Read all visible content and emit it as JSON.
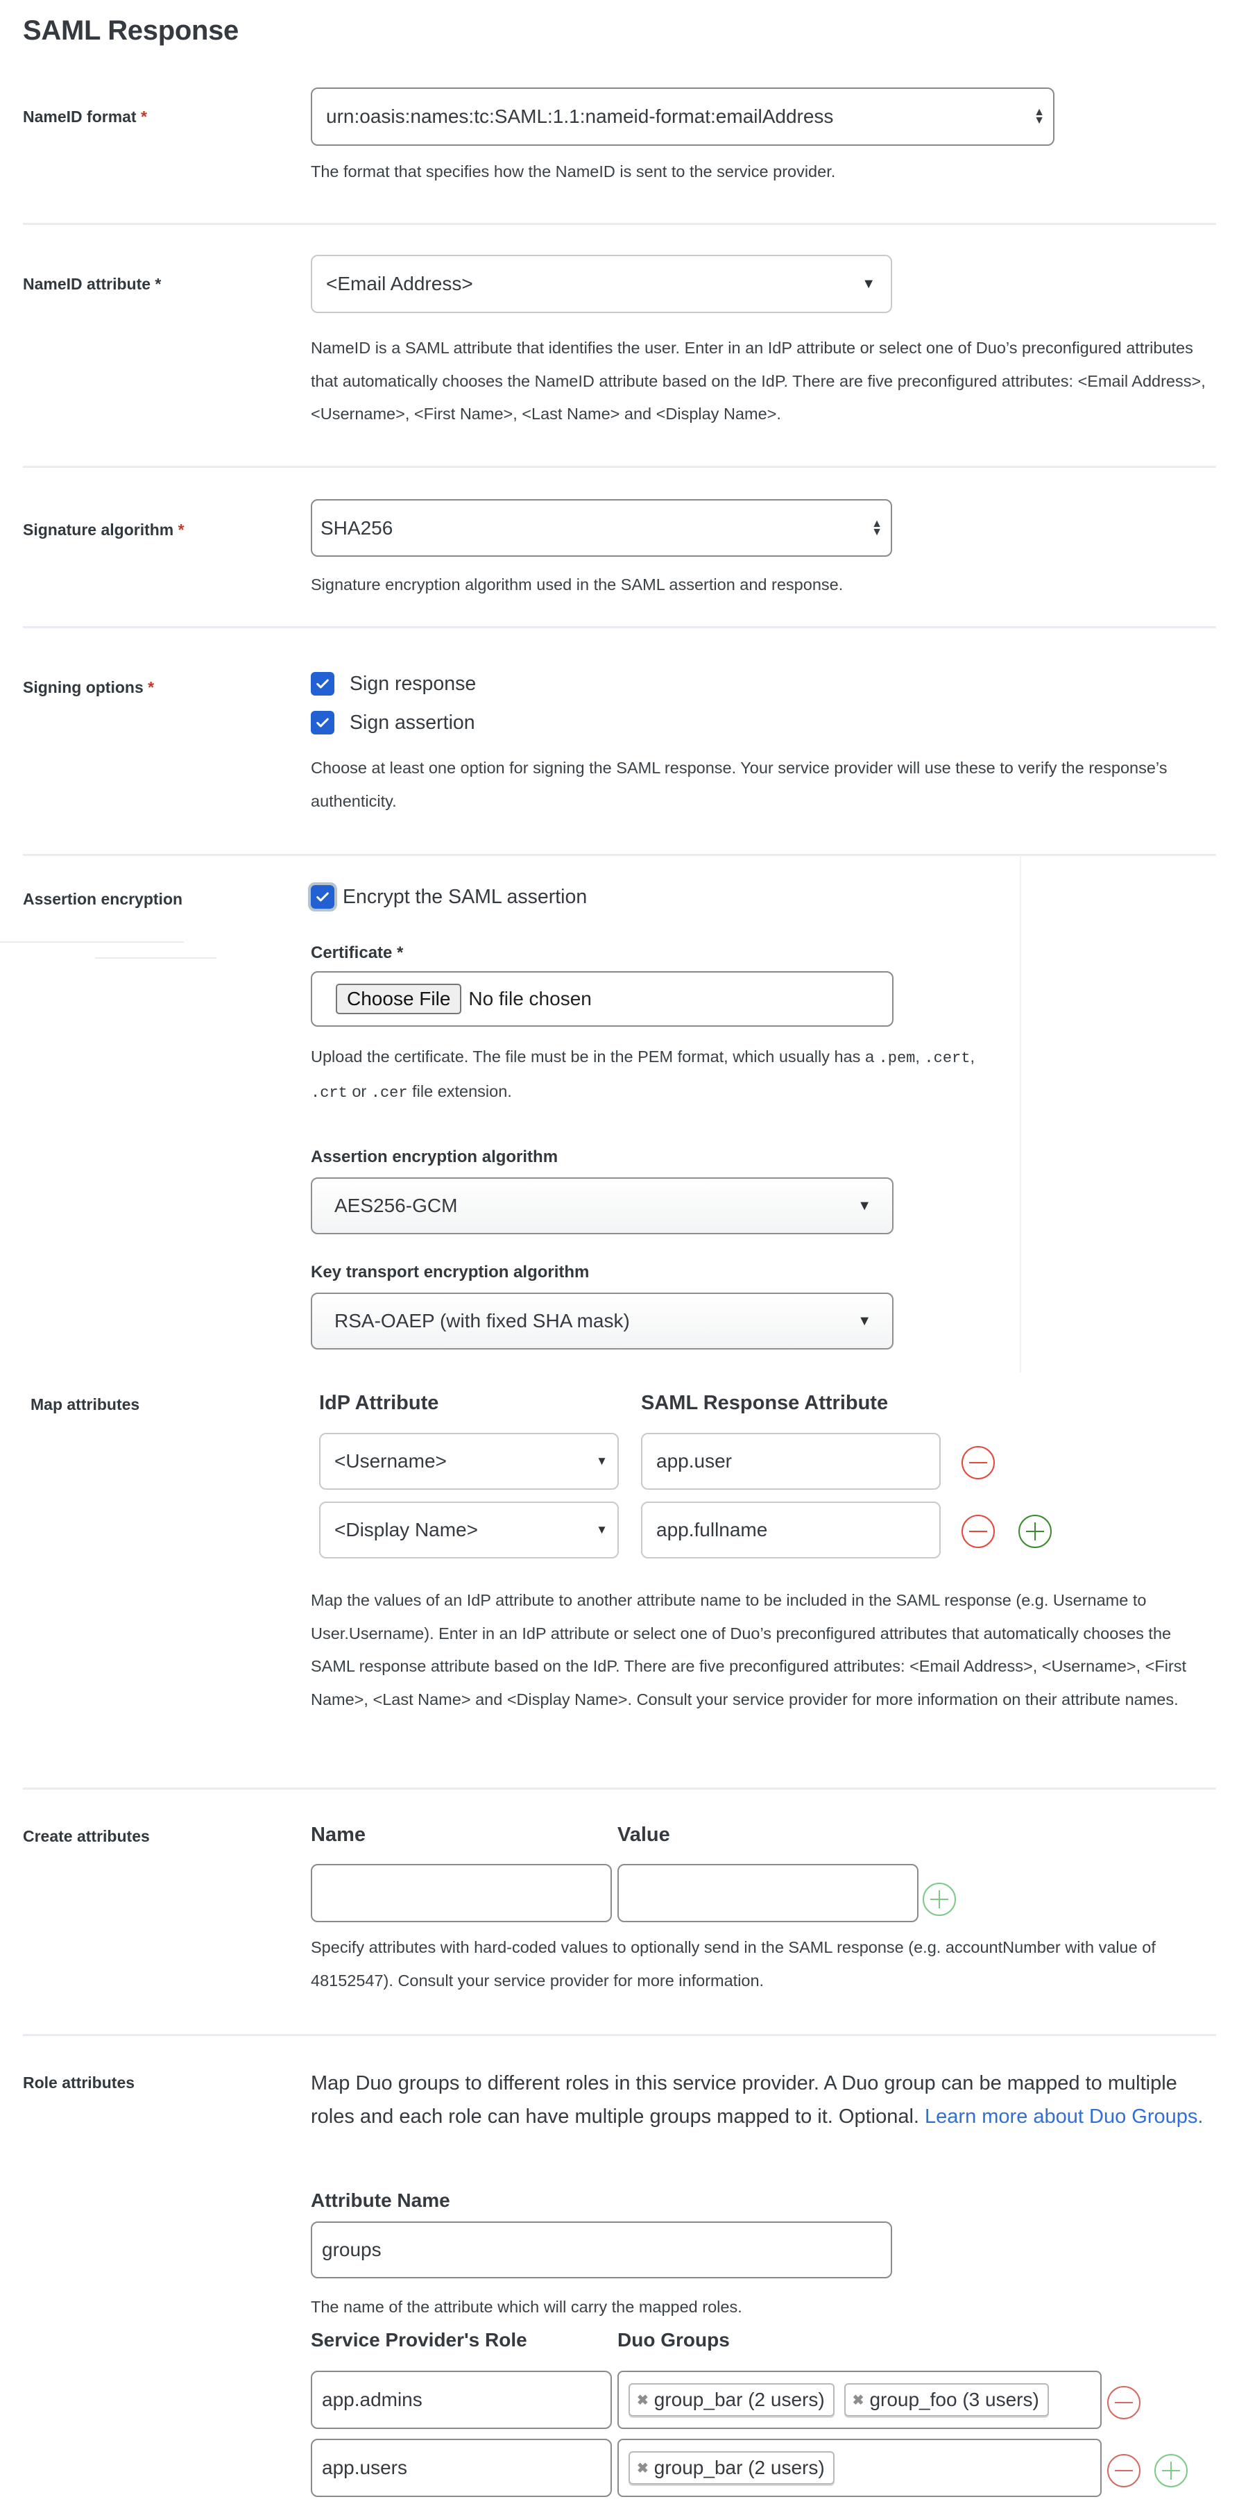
{
  "page": {
    "title": "SAML Response"
  },
  "nameid_format": {
    "label": "NameID format",
    "required_mark": "*",
    "value": "urn:oasis:names:tc:SAML:1.1:nameid-format:emailAddress",
    "help": "The format that specifies how the NameID is sent to the service provider."
  },
  "nameid_attribute": {
    "label": "NameID attribute *",
    "value": "<Email Address>",
    "help": "NameID is a SAML attribute that identifies the user. Enter in an IdP attribute or select one of Duo’s preconfigured attributes that automatically chooses the NameID attribute based on the IdP. There are five preconfigured attributes: <Email Address>, <Username>, <First Name>, <Last Name> and <Display Name>."
  },
  "signature_algorithm": {
    "label": "Signature algorithm",
    "required_mark": "*",
    "value": "SHA256",
    "help": "Signature encryption algorithm used in the SAML assertion and response."
  },
  "signing_options": {
    "label": "Signing options",
    "required_mark": "*",
    "options": [
      {
        "label": "Sign response",
        "checked": true
      },
      {
        "label": "Sign assertion",
        "checked": true
      }
    ],
    "help": "Choose at least one option for signing the SAML response. Your service provider will use these to verify the response’s authenticity."
  },
  "assertion_encryption": {
    "label": "Assertion encryption",
    "checkbox_label": "Encrypt the SAML assertion",
    "checked": true,
    "certificate": {
      "label": "Certificate *",
      "button": "Choose File",
      "status": "No file chosen",
      "help_prefix": "Upload the certificate. The file must be in the PEM format, which usually has a ",
      "ext_pem": ".pem",
      "sep1": ", ",
      "ext_cert": ".cert",
      "sep2": ",",
      "ext_crt": ".crt",
      "or": " or ",
      "ext_cer": ".cer",
      "help_suffix": " file extension."
    },
    "algorithm": {
      "label": "Assertion encryption algorithm",
      "value": "AES256-GCM"
    },
    "key_transport": {
      "label": "Key transport encryption algorithm",
      "value": "RSA-OAEP (with fixed SHA mask)"
    }
  },
  "map_attributes": {
    "label": "Map attributes",
    "col_idp": "IdP Attribute",
    "col_saml": "SAML Response Attribute",
    "rows": [
      {
        "idp": "<Username>",
        "saml": "app.user"
      },
      {
        "idp": "<Display Name>",
        "saml": "app.fullname"
      }
    ],
    "help": "Map the values of an IdP attribute to another attribute name to be included in the SAML response (e.g. Username to User.Username). Enter in an IdP attribute or select one of Duo’s preconfigured attributes that automatically chooses the SAML response attribute based on the IdP. There are five preconfigured attributes: <Email Address>, <Username>, <First Name>, <Last Name> and <Display Name>. Consult your service provider for more information on their attribute names."
  },
  "create_attributes": {
    "label": "Create attributes",
    "col_name": "Name",
    "col_value": "Value",
    "name_value": "",
    "value_value": "",
    "help": "Specify attributes with hard-coded values to optionally send in the SAML response (e.g. accountNumber with value of 48152547). Consult your service provider for more information."
  },
  "role_attributes": {
    "label": "Role attributes",
    "intro": "Map Duo groups to different roles in this service provider. A Duo group can be mapped to multiple roles and each role can have multiple groups mapped to it. Optional. ",
    "link": "Learn more about Duo Groups.",
    "attr_name_label": "Attribute Name",
    "attr_name_value": "groups",
    "attr_name_help": "The name of the attribute which will carry the mapped roles.",
    "col_role": "Service Provider's Role",
    "col_groups": "Duo Groups",
    "rows": [
      {
        "role": "app.admins",
        "groups": [
          "group_bar (2 users)",
          "group_foo (3 users)"
        ]
      },
      {
        "role": "app.users",
        "groups": [
          "group_bar (2 users)"
        ]
      }
    ]
  },
  "colors": {
    "accent": "#2261d4",
    "link": "#2f6fd6",
    "required": "#c0392b",
    "remove": "#e4473c",
    "add": "#3c8a2e",
    "add_soft": "#7cc98a"
  }
}
